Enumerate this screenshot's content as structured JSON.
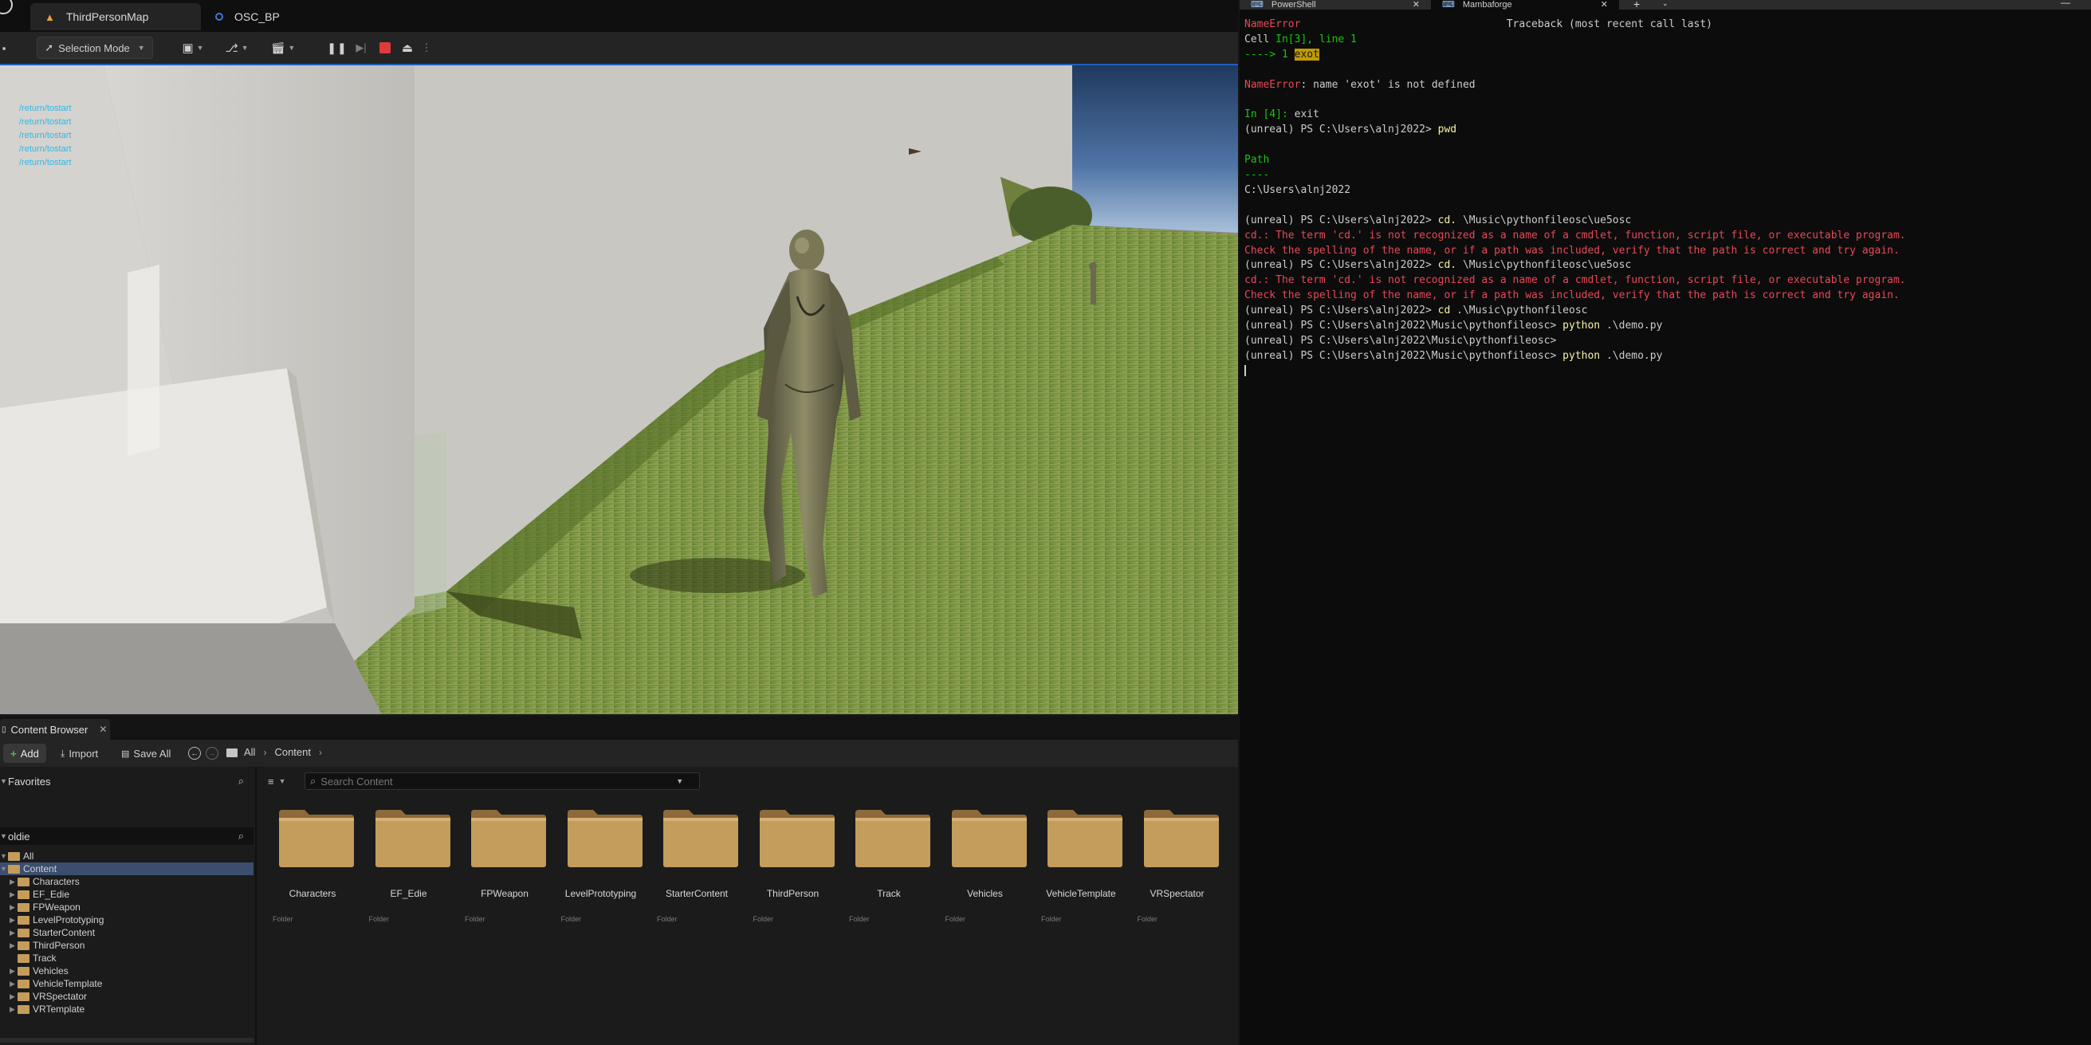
{
  "editor": {
    "tabs": [
      {
        "label": "ThirdPersonMap"
      },
      {
        "label": "OSC_BP"
      }
    ],
    "toolbar": {
      "mode_label": "Selection Mode"
    },
    "viewport": {
      "debug_lines": [
        "/return/tostart",
        "/return/tostart",
        "/return/tostart",
        "/return/tostart",
        "/return/tostart"
      ]
    }
  },
  "content_browser": {
    "tab_label": "Content Browser",
    "add_label": "Add",
    "import_label": "Import",
    "save_all_label": "Save All",
    "breadcrumb": [
      "All",
      "Content"
    ],
    "favorites_label": "Favorites",
    "filter_value": "oldie",
    "search_placeholder": "Search Content",
    "tree": [
      {
        "label": "All",
        "expanded": true
      },
      {
        "label": "Content",
        "expanded": true,
        "selected": true
      },
      {
        "label": "Characters"
      },
      {
        "label": "EF_Edie"
      },
      {
        "label": "FPWeapon"
      },
      {
        "label": "LevelPrototyping"
      },
      {
        "label": "StarterContent"
      },
      {
        "label": "ThirdPerson"
      },
      {
        "label": "Track"
      },
      {
        "label": "Vehicles"
      },
      {
        "label": "VehicleTemplate"
      },
      {
        "label": "VRSpectator"
      },
      {
        "label": "VRTemplate"
      }
    ],
    "folders": [
      {
        "label": "Characters",
        "type": "Folder"
      },
      {
        "label": "EF_Edie",
        "type": "Folder"
      },
      {
        "label": "FPWeapon",
        "type": "Folder"
      },
      {
        "label": "LevelPrototyping",
        "type": "Folder"
      },
      {
        "label": "StarterContent",
        "type": "Folder"
      },
      {
        "label": "ThirdPerson",
        "type": "Folder"
      },
      {
        "label": "Track",
        "type": "Folder"
      },
      {
        "label": "Vehicles",
        "type": "Folder"
      },
      {
        "label": "VehicleTemplate",
        "type": "Folder"
      },
      {
        "label": "VRSpectator",
        "type": "Folder"
      }
    ]
  },
  "terminal": {
    "tabs": [
      {
        "label": "PowerShell"
      },
      {
        "label": "Mambaforge"
      }
    ],
    "lines": [
      {
        "segs": [
          {
            "t": "NameError",
            "c": "#e74856"
          },
          {
            "t": "                                 Traceback (most recent call last)",
            "c": "#cccccc"
          }
        ]
      },
      {
        "segs": [
          {
            "t": "Cell ",
            "c": "#cccccc"
          },
          {
            "t": "In[3], line 1",
            "c": "#16c60c"
          }
        ]
      },
      {
        "segs": [
          {
            "t": "----> 1 ",
            "c": "#16c60c"
          },
          {
            "t": "exot",
            "c": "#1a1a1a",
            "bg": "#c19c00"
          }
        ]
      },
      {
        "segs": []
      },
      {
        "segs": [
          {
            "t": "NameError",
            "c": "#e74856"
          },
          {
            "t": ": name 'exot' is not defined",
            "c": "#cccccc"
          }
        ]
      },
      {
        "segs": []
      },
      {
        "segs": [
          {
            "t": "In [4]: ",
            "c": "#16c60c"
          },
          {
            "t": "exit",
            "c": "#cccccc"
          }
        ]
      },
      {
        "segs": [
          {
            "t": "(unreal) PS C:\\Users\\alnj2022> ",
            "c": "#cccccc"
          },
          {
            "t": "pwd",
            "c": "#f9f1a5"
          }
        ]
      },
      {
        "segs": []
      },
      {
        "segs": [
          {
            "t": "Path",
            "c": "#16c60c"
          }
        ]
      },
      {
        "segs": [
          {
            "t": "----",
            "c": "#16c60c"
          }
        ]
      },
      {
        "segs": [
          {
            "t": "C:\\Users\\alnj2022",
            "c": "#cccccc"
          }
        ]
      },
      {
        "segs": []
      },
      {
        "segs": [
          {
            "t": "(unreal) PS C:\\Users\\alnj2022> ",
            "c": "#cccccc"
          },
          {
            "t": "cd.",
            "c": "#f9f1a5"
          },
          {
            "t": " \\Music\\pythonfileosc\\ue5osc",
            "c": "#cccccc"
          }
        ]
      },
      {
        "segs": [
          {
            "t": "cd.: The term 'cd.' is not recognized as a name of a cmdlet, function, script file, or executable program.",
            "c": "#e74856"
          }
        ]
      },
      {
        "segs": [
          {
            "t": "Check the spelling of the name, or if a path was included, verify that the path is correct and try again.",
            "c": "#e74856"
          }
        ]
      },
      {
        "segs": [
          {
            "t": "(unreal) PS C:\\Users\\alnj2022> ",
            "c": "#cccccc"
          },
          {
            "t": "cd.",
            "c": "#f9f1a5"
          },
          {
            "t": " \\Music\\pythonfileosc\\ue5osc",
            "c": "#cccccc"
          }
        ]
      },
      {
        "segs": [
          {
            "t": "cd.: The term 'cd.' is not recognized as a name of a cmdlet, function, script file, or executable program.",
            "c": "#e74856"
          }
        ]
      },
      {
        "segs": [
          {
            "t": "Check the spelling of the name, or if a path was included, verify that the path is correct and try again.",
            "c": "#e74856"
          }
        ]
      },
      {
        "segs": [
          {
            "t": "(unreal) PS C:\\Users\\alnj2022> ",
            "c": "#cccccc"
          },
          {
            "t": "cd",
            "c": "#f9f1a5"
          },
          {
            "t": " .\\Music\\pythonfileosc",
            "c": "#cccccc"
          }
        ]
      },
      {
        "segs": [
          {
            "t": "(unreal) PS C:\\Users\\alnj2022\\Music\\pythonfileosc> ",
            "c": "#cccccc"
          },
          {
            "t": "python",
            "c": "#f9f1a5"
          },
          {
            "t": " .\\demo.py",
            "c": "#cccccc"
          }
        ]
      },
      {
        "segs": [
          {
            "t": "(unreal) PS C:\\Users\\alnj2022\\Music\\pythonfileosc>",
            "c": "#cccccc"
          }
        ]
      },
      {
        "segs": [
          {
            "t": "(unreal) PS C:\\Users\\alnj2022\\Music\\pythonfileosc> ",
            "c": "#cccccc"
          },
          {
            "t": "python",
            "c": "#f9f1a5"
          },
          {
            "t": " .\\demo.py",
            "c": "#cccccc"
          }
        ]
      }
    ]
  },
  "colors": {
    "accent": "#1f5fbf",
    "selection": "#3b4e6d",
    "folder": "#c49c5b",
    "error_red": "#e74856",
    "prompt_green": "#16c60c",
    "command_yellow": "#f9f1a5",
    "stop_red": "#e03a3a"
  }
}
